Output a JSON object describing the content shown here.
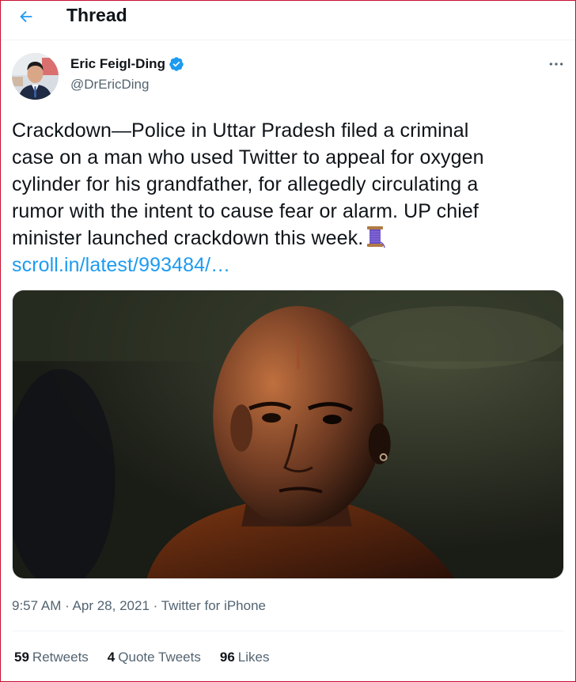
{
  "header": {
    "back_icon": "arrow-left-icon",
    "title": "Thread"
  },
  "author": {
    "name": "Eric Feigl-Ding",
    "handle": "@DrEricDing",
    "verified_icon": "verified-badge-icon",
    "more_icon": "more-horizontal-icon"
  },
  "tweet": {
    "lines": [
      "Crackdown—Police in Uttar Pradesh filed a criminal",
      "case on a man who used Twitter to appeal for oxygen",
      "cylinder for his grandfather, for allegedly circulating a",
      "rumor with the intent to cause fear or alarm. UP chief",
      "minister launched crackdown this week."
    ],
    "emoji_icon": "thread-spool-icon",
    "link": "scroll.in/latest/993484/…"
  },
  "meta": {
    "time": "9:57 AM",
    "sep1": " · ",
    "date": "Apr 28, 2021",
    "sep2": " · ",
    "source": "Twitter for iPhone"
  },
  "stats": {
    "retweets_count": "59",
    "retweets_label": "Retweets",
    "quotes_count": "4",
    "quotes_label": "Quote Tweets",
    "likes_count": "96",
    "likes_label": "Likes"
  },
  "colors": {
    "accent": "#1d9bf0",
    "text": "#0f1419",
    "secondary": "#536471",
    "frame": "#c8102e"
  }
}
